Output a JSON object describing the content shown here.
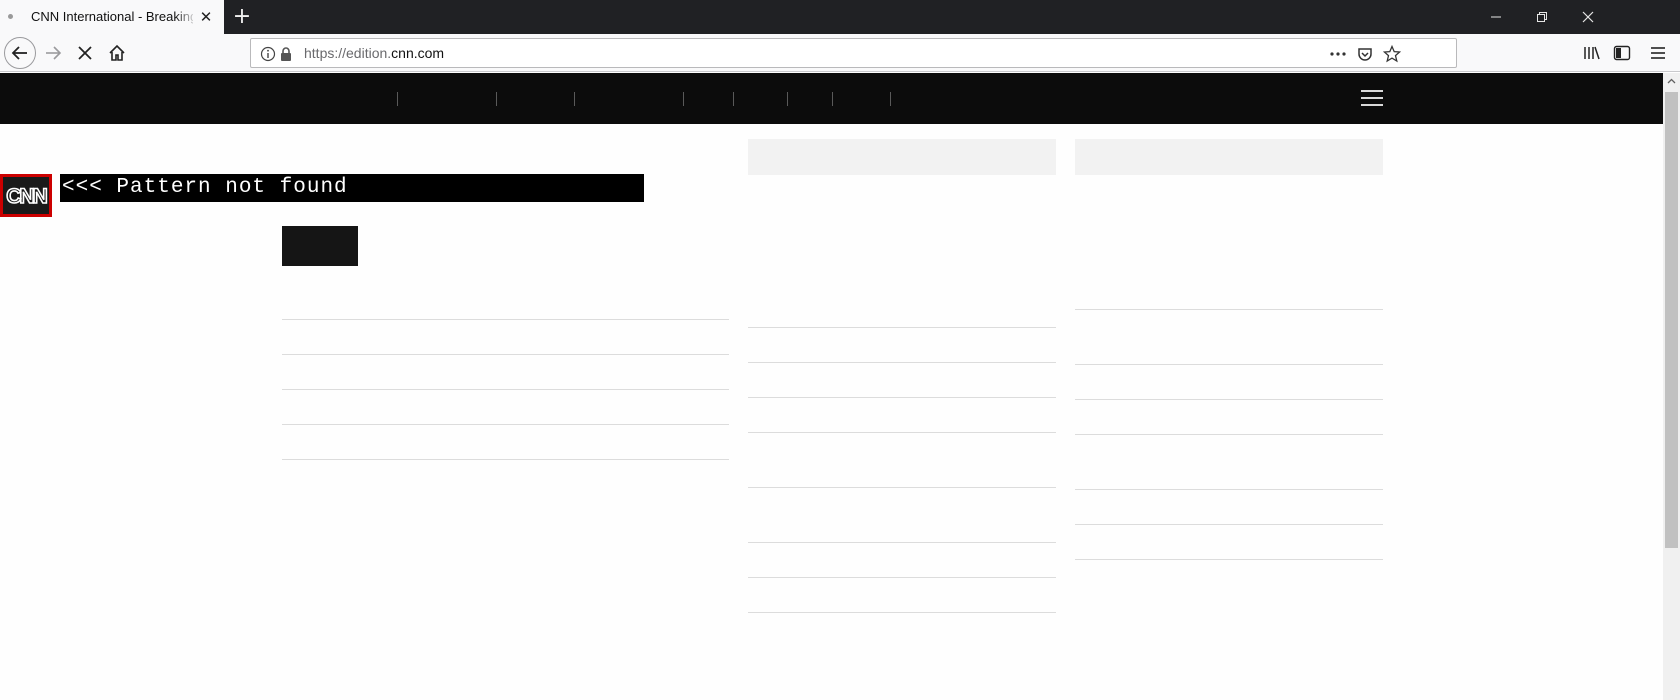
{
  "browser": {
    "tab_title": "CNN International - Breaking News, US News, World News and Video",
    "close_tab_glyph": "✕",
    "new_tab_glyph": "+",
    "url_prefix": "https://edition.",
    "url_host": "cnn.com"
  },
  "icons": {
    "favicon": "loading-dot-icon",
    "back": "back-arrow-icon",
    "forward": "forward-arrow-icon",
    "stop": "stop-loading-icon",
    "home": "home-icon",
    "site_info": "info-icon",
    "lock": "lock-icon",
    "page_actions": "more-icon",
    "pocket": "pocket-icon",
    "bookmark": "star-icon",
    "library": "library-icon",
    "sidebar": "sidebar-icon",
    "app_menu": "menu-icon",
    "site_menu": "hamburger-icon",
    "logo": "cnn-logo"
  },
  "page": {
    "logo_text": "CNN",
    "error_banner": "<<< Pattern not found"
  },
  "colors": {
    "site_nav_bg": "#0c0c0c",
    "logo_border": "#cc0000",
    "placeholder_header": "#f2f2f2"
  }
}
